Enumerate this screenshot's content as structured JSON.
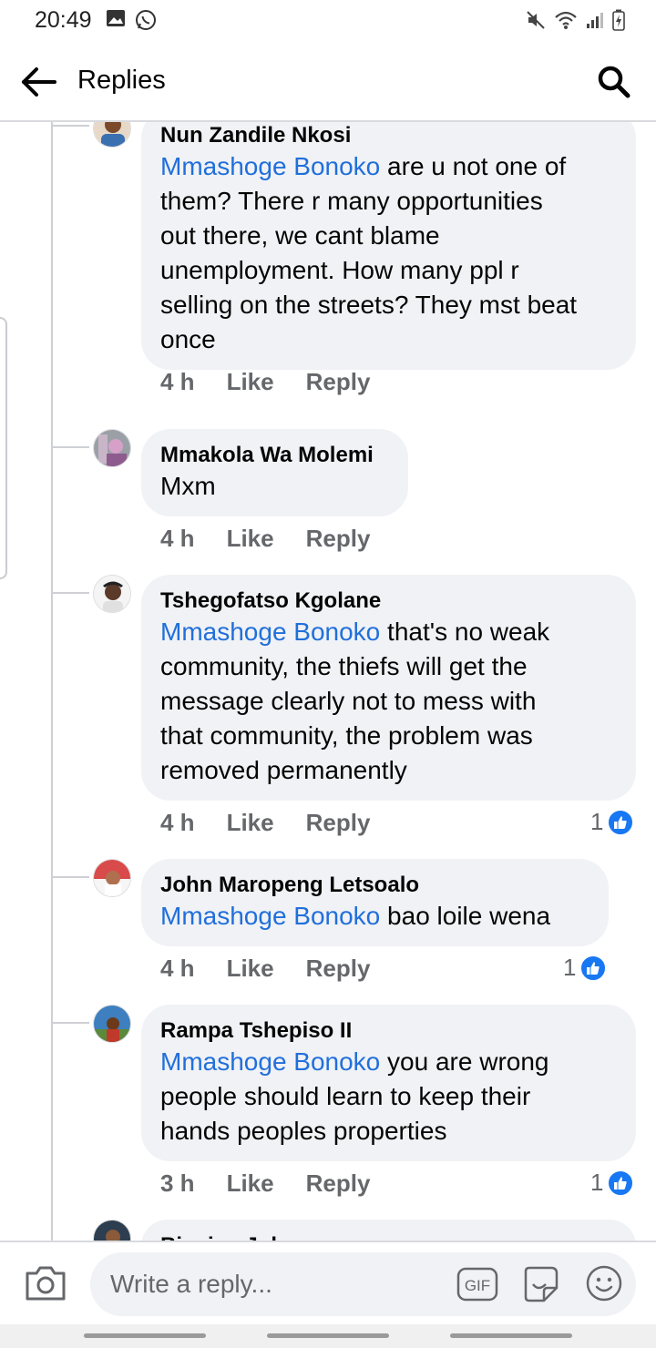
{
  "status_bar": {
    "time": "20:49",
    "left_icons": [
      "gallery-icon",
      "whatsapp-icon"
    ],
    "right_icons": [
      "mute-icon",
      "wifi-icon",
      "signal-icon",
      "battery-charging-icon"
    ]
  },
  "app_bar": {
    "title": "Replies",
    "back_icon": "back-arrow-icon",
    "search_icon": "search-icon"
  },
  "comments": [
    {
      "author": "Nun Zandile Nkosi",
      "mention": "Mmashoge Bonoko",
      "lines": [
        "are u not one of",
        "them? There r many opportunities",
        "out there, we cant blame",
        "unemployment. How many ppl r",
        "selling on the streets? They mst beat",
        "once"
      ],
      "time": "4 h",
      "like_label": "Like",
      "reply_label": "Reply"
    },
    {
      "author": "Mmakola Wa Molemi",
      "mention": "",
      "lines": [
        "Mxm"
      ],
      "time": "4 h",
      "like_label": "Like",
      "reply_label": "Reply"
    },
    {
      "author": "Tshegofatso Kgolane",
      "mention": "Mmashoge Bonoko",
      "lines": [
        "that's no weak",
        "community, the thiefs will get the",
        "message clearly not to mess with",
        "that community, the problem was",
        "removed permanently"
      ],
      "time": "4 h",
      "like_label": "Like",
      "reply_label": "Reply",
      "reaction_count": "1"
    },
    {
      "author": "John Maropeng Letsoalo",
      "mention": "Mmashoge Bonoko",
      "lines": [
        "bao loile wena"
      ],
      "time": "4 h",
      "like_label": "Like",
      "reply_label": "Reply",
      "reaction_count": "1"
    },
    {
      "author": "Rampa Tshepiso II",
      "mention": "Mmashoge Bonoko",
      "lines": [
        "you are wrong",
        "people should learn to keep their",
        "hands peoples properties"
      ],
      "time": "3 h",
      "like_label": "Like",
      "reply_label": "Reply",
      "reaction_count": "1"
    },
    {
      "author": "Bigvian Johannes"
    }
  ],
  "composer": {
    "placeholder": "Write a reply...",
    "gif_label": "GIF",
    "icons": [
      "camera-icon",
      "gif-icon",
      "sticker-icon",
      "emoji-icon"
    ]
  },
  "colors": {
    "mention": "#216fdb",
    "bubble": "#f0f2f5",
    "like_blue": "#1877f2",
    "meta_gray": "#65676b"
  }
}
